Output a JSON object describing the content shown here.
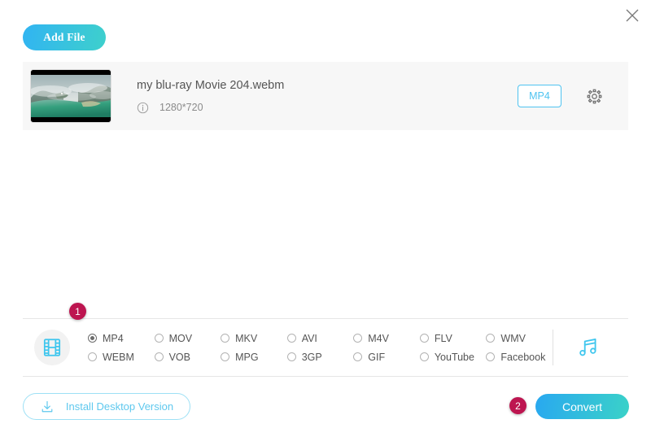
{
  "window": {
    "close_icon": "close-icon"
  },
  "toolbar": {
    "add_file_label": "Add File"
  },
  "file": {
    "name": "my blu-ray Movie 204.webm",
    "resolution": "1280*720",
    "info_icon": "info-icon",
    "format_tag": "MP4",
    "settings_icon": "gear-icon",
    "thumbnail_alt": "aerial-landscape-thumbnail"
  },
  "badges": {
    "step_one": "1",
    "step_two": "2"
  },
  "format_panel": {
    "video_icon": "film-strip-icon",
    "audio_icon": "music-note-icon",
    "selected": "MP4",
    "options": [
      {
        "label": "MP4",
        "checked": true
      },
      {
        "label": "MOV",
        "checked": false
      },
      {
        "label": "MKV",
        "checked": false
      },
      {
        "label": "AVI",
        "checked": false
      },
      {
        "label": "M4V",
        "checked": false
      },
      {
        "label": "FLV",
        "checked": false
      },
      {
        "label": "WMV",
        "checked": false
      },
      {
        "label": "WEBM",
        "checked": false
      },
      {
        "label": "VOB",
        "checked": false
      },
      {
        "label": "MPG",
        "checked": false
      },
      {
        "label": "3GP",
        "checked": false
      },
      {
        "label": "GIF",
        "checked": false
      },
      {
        "label": "YouTube",
        "checked": false
      },
      {
        "label": "Facebook",
        "checked": false
      }
    ]
  },
  "footer": {
    "install_label": "Install Desktop Version",
    "install_icon": "download-icon",
    "convert_label": "Convert"
  },
  "colors": {
    "accent_blue": "#31b4f2",
    "accent_teal": "#3ed0cc",
    "badge": "#bd1550",
    "tag_border": "#4fc3f0",
    "install_border": "#9de0f5",
    "panel_bg": "#f7f7f7"
  }
}
